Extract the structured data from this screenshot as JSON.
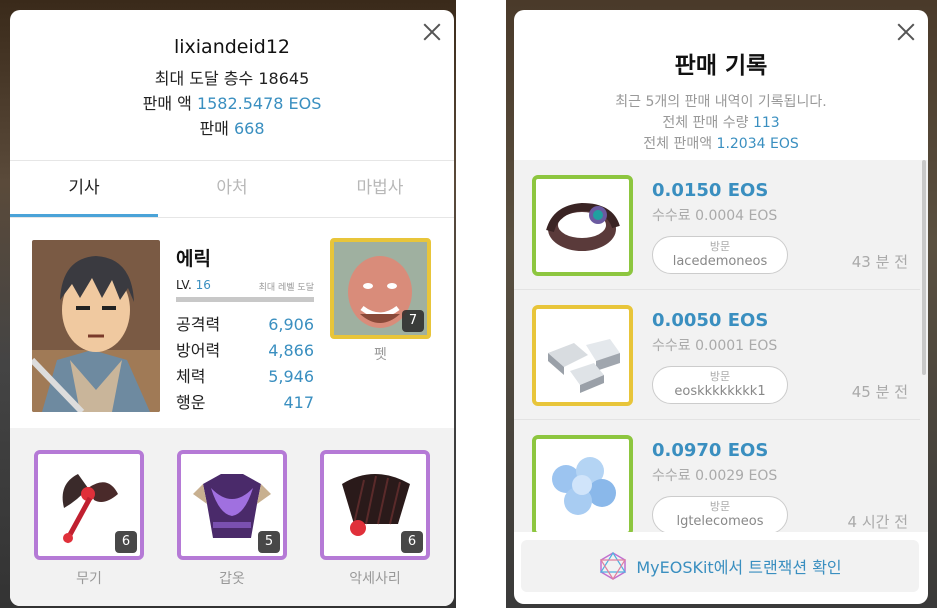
{
  "left": {
    "username": "lixiandeid12",
    "max_floor_label": "최대 도달 층수",
    "max_floor_value": "18645",
    "sales_amount_label": "판매 액",
    "sales_amount_value": "1582.5478 EOS",
    "sales_count_label": "판매",
    "sales_count_value": "668",
    "tabs": [
      "기사",
      "아처",
      "마법사"
    ],
    "active_tab": 0,
    "hero": {
      "name": "에릭",
      "lv_label": "LV.",
      "lv_value": "16",
      "max_level_text": "최대 레벨 도달",
      "stats": [
        {
          "label": "공격력",
          "value": "6,906"
        },
        {
          "label": "방어력",
          "value": "4,866"
        },
        {
          "label": "체력",
          "value": "5,946"
        },
        {
          "label": "행운",
          "value": "417"
        }
      ]
    },
    "pet": {
      "label": "펫",
      "level": "7"
    },
    "equipment": [
      {
        "label": "무기",
        "level": "6",
        "icon": "axe-icon"
      },
      {
        "label": "갑옷",
        "level": "5",
        "icon": "armor-icon"
      },
      {
        "label": "악세사리",
        "level": "6",
        "icon": "fan-icon"
      }
    ]
  },
  "right": {
    "title": "판매 기록",
    "subtitle": "최근 5개의 판매 내역이 기록됩니다.",
    "total_count_label": "전체 판매 수량",
    "total_count_value": "113",
    "total_amount_label": "전체 판매액",
    "total_amount_value": "1.2034 EOS",
    "sales": [
      {
        "amount": "0.0150 EOS",
        "fee": "수수료 0.0004 EOS",
        "visit_label": "방문",
        "account": "lacedemoneos",
        "time": "43 분 전",
        "icon": "bracelet-icon",
        "border": "#8dc63f"
      },
      {
        "amount": "0.0050 EOS",
        "fee": "수수료 0.0001 EOS",
        "visit_label": "방문",
        "account": "eoskkkkkkkk1",
        "time": "45 분 전",
        "icon": "silver-ore-icon",
        "border": "#e8c53a"
      },
      {
        "amount": "0.0970 EOS",
        "fee": "수수료 0.0029 EOS",
        "visit_label": "방문",
        "account": "lgtelecomeos",
        "time": "4 시간 전",
        "icon": "crystal-ore-icon",
        "border": "#8dc63f"
      }
    ],
    "confirm_label": "MyEOSKit에서 트랜잭션 확인"
  },
  "colors": {
    "accent": "#3a8fc0",
    "tab_underline": "#4aa3d8",
    "epic_border": "#b57ad6",
    "gold_border": "#e8c53a",
    "green_border": "#8dc63f"
  }
}
